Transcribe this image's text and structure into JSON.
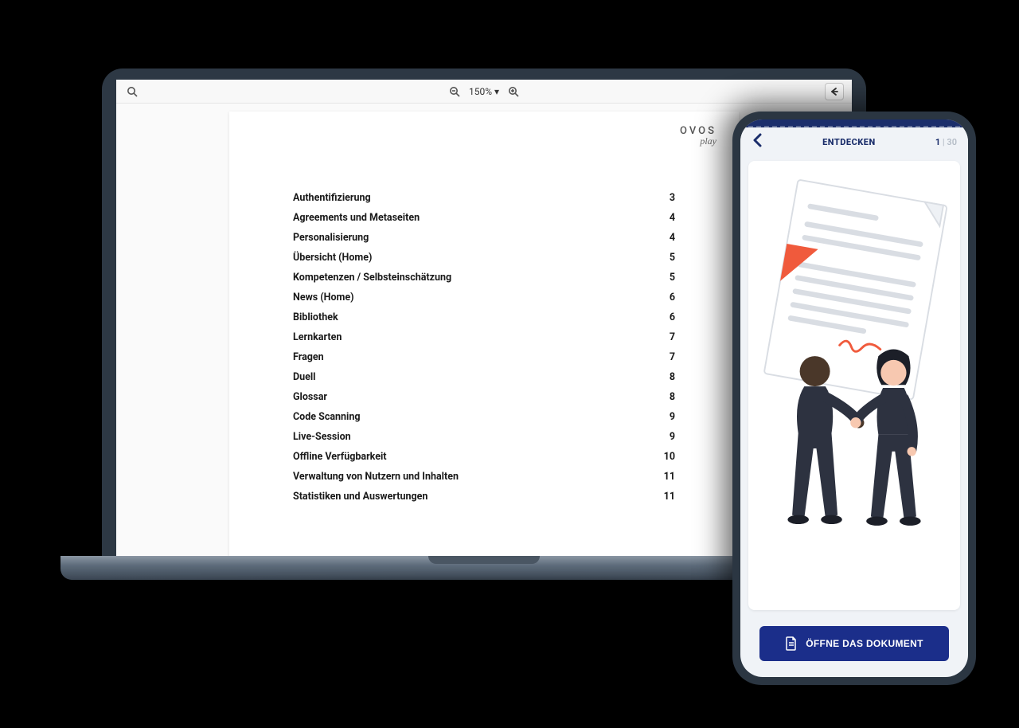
{
  "laptop": {
    "toolbar": {
      "zoom": "150%",
      "zoom_caret": "▾"
    },
    "document": {
      "brand_main": "OVOS",
      "brand_sub": "play",
      "toc": [
        {
          "title": "Authentifizierung",
          "page": "3"
        },
        {
          "title": "Agreements und Metaseiten",
          "page": "4"
        },
        {
          "title": "Personalisierung",
          "page": "4"
        },
        {
          "title": "Übersicht (Home)",
          "page": "5"
        },
        {
          "title": "Kompetenzen / Selbsteinschätzung",
          "page": "5"
        },
        {
          "title": "News (Home)",
          "page": "6"
        },
        {
          "title": "Bibliothek",
          "page": "6"
        },
        {
          "title": "Lernkarten",
          "page": "7"
        },
        {
          "title": "Fragen",
          "page": "7"
        },
        {
          "title": "Duell",
          "page": "8"
        },
        {
          "title": "Glossar",
          "page": "8"
        },
        {
          "title": "Code Scanning",
          "page": "9"
        },
        {
          "title": "Live-Session",
          "page": "9"
        },
        {
          "title": "Offline Verfügbarkeit",
          "page": "10"
        },
        {
          "title": "Verwaltung von Nutzern und Inhalten",
          "page": "11"
        },
        {
          "title": "Statistiken und Auswertungen",
          "page": "11"
        }
      ]
    }
  },
  "phone": {
    "header": {
      "title": "ENTDECKEN",
      "current": "1",
      "separator": " | ",
      "total": "30"
    },
    "cta_label": "ÖFFNE DAS DOKUMENT"
  }
}
